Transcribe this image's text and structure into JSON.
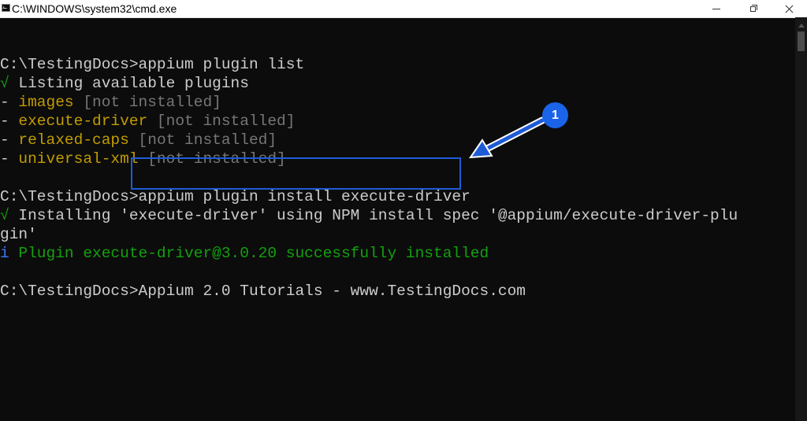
{
  "window": {
    "title": "C:\\WINDOWS\\system32\\cmd.exe",
    "icon": "console-icon",
    "buttons": [
      "minimize-icon",
      "maximize-icon",
      "close-icon"
    ]
  },
  "console": {
    "lines": [
      [
        {
          "t": "",
          "c": ""
        }
      ],
      [
        {
          "t": "C:\\TestingDocs>appium plugin list",
          "c": ""
        }
      ],
      [
        {
          "t": "√",
          "c": "ok"
        },
        {
          "t": " Listing available plugins",
          "c": ""
        }
      ],
      [
        {
          "t": "- ",
          "c": ""
        },
        {
          "t": "images",
          "c": "name"
        },
        {
          "t": " [not installed]",
          "c": "dim"
        }
      ],
      [
        {
          "t": "- ",
          "c": ""
        },
        {
          "t": "execute-driver",
          "c": "name"
        },
        {
          "t": " [not installed]",
          "c": "dim"
        }
      ],
      [
        {
          "t": "- ",
          "c": ""
        },
        {
          "t": "relaxed-caps",
          "c": "name"
        },
        {
          "t": " [not installed]",
          "c": "dim"
        }
      ],
      [
        {
          "t": "- ",
          "c": ""
        },
        {
          "t": "universal-xml",
          "c": "name"
        },
        {
          "t": " [not installed]",
          "c": "dim"
        }
      ],
      [
        {
          "t": "",
          "c": ""
        }
      ],
      [
        {
          "t": "C:\\TestingDocs>appium plugin install execute-driver",
          "c": ""
        }
      ],
      [
        {
          "t": "√",
          "c": "ok"
        },
        {
          "t": " Installing 'execute-driver' using NPM install spec '@appium/execute-driver-plu",
          "c": ""
        }
      ],
      [
        {
          "t": "gin'",
          "c": ""
        }
      ],
      [
        {
          "t": "i",
          "c": "info"
        },
        {
          "t": " Plugin execute-driver@3.0.20 successfully installed",
          "c": "success"
        }
      ],
      [
        {
          "t": "",
          "c": ""
        }
      ],
      [
        {
          "t": "C:\\TestingDocs>Appium 2.0 Tutorials - www.TestingDocs.com",
          "c": ""
        }
      ]
    ]
  },
  "annotation": {
    "badge_label": "1",
    "color": "#1e5cd6"
  },
  "colors": {
    "background": "#0c0c0c",
    "text": "#cccccc",
    "success_green": "#13a10e",
    "plugin_yellow": "#c19c00",
    "muted_gray": "#767676",
    "info_blue": "#3b78ff"
  }
}
